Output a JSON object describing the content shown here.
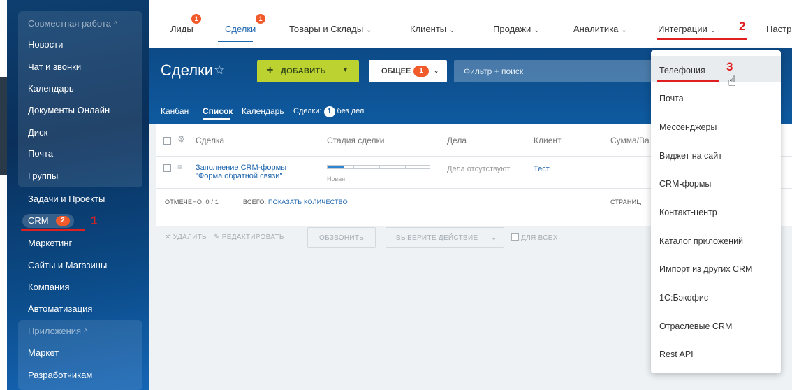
{
  "sidebar": {
    "items": [
      {
        "label": "Совместная работа",
        "muted": true,
        "caret": "^"
      },
      {
        "label": "Новости"
      },
      {
        "label": "Чат и звонки"
      },
      {
        "label": "Календарь"
      },
      {
        "label": "Документы Онлайн"
      },
      {
        "label": "Диск"
      },
      {
        "label": "Почта"
      },
      {
        "label": "Группы"
      },
      {
        "label": "Задачи и Проекты"
      },
      {
        "label": "Маркетинг"
      },
      {
        "label": "Сайты и Магазины"
      },
      {
        "label": "Компания"
      },
      {
        "label": "Автоматизация"
      },
      {
        "label": "Приложения",
        "muted": true,
        "caret": "^"
      },
      {
        "label": "Маркет"
      },
      {
        "label": "Разработчикам"
      }
    ],
    "crm": {
      "label": "CRM",
      "count": "2"
    }
  },
  "annotations": {
    "one": "1",
    "two": "2",
    "three": "3",
    "color": "#e02020"
  },
  "topnav": {
    "items": [
      {
        "label": "Лиды",
        "badge": "1"
      },
      {
        "label": "Сделки",
        "badge": "1",
        "active": true
      },
      {
        "label": "Товары и Склады"
      },
      {
        "label": "Клиенты"
      },
      {
        "label": "Продажи"
      },
      {
        "label": "Аналитика"
      },
      {
        "label": "Интеграции"
      },
      {
        "label": "Настр"
      }
    ]
  },
  "toolbar": {
    "title": "Сделки",
    "add_label": "ДОБАВИТЬ",
    "preset_label": "ОБЩЕЕ",
    "preset_count": "1",
    "filter_placeholder": "Фильтр + поиск"
  },
  "views": {
    "items": [
      "Канбан",
      "Список",
      "Календарь"
    ],
    "deals_label": "Сделки:",
    "deals_count": "1",
    "deals_suffix": "без дел"
  },
  "grid": {
    "columns": [
      "Сделка",
      "Стадия сделки",
      "Дела",
      "Клиент",
      "Сумма/Ва"
    ],
    "rows": [
      {
        "deal_line1": "Заполнение CRM-формы",
        "deal_line2": "\"Форма обратной связи\"",
        "stage": "Новая",
        "stage_progress": 0.16,
        "activities": "Дела отсутствуют",
        "client": "Тест"
      }
    ],
    "footer": {
      "selected": "ОТМЕЧЕНО: 0 / 1",
      "total_label": "ВСЕГО:",
      "total_link": "ПОКАЗАТЬ КОЛИЧЕСТВО",
      "pages": "СТРАНИЦ"
    }
  },
  "actions": {
    "delete": "УДАЛИТЬ",
    "edit": "РЕДАКТИРОВАТЬ",
    "call": "ОБЗВОНИТЬ",
    "choose": "ВЫБЕРИТЕ ДЕЙСТВИЕ",
    "for_all": "ДЛЯ ВСЕХ"
  },
  "integrations_menu": {
    "items": [
      "Телефония",
      "Почта",
      "Мессенджеры",
      "Виджет на сайт",
      "CRM-формы",
      "Контакт-центр",
      "Каталог приложений",
      "Импорт из других CRM",
      "1С:Бэкофис",
      "Отраслевые CRM",
      "Rest API"
    ],
    "hover_index": 0
  },
  "colors": {
    "accent": "#2067b0",
    "badge": "#f15a2b",
    "add_button": "#bbd230"
  }
}
